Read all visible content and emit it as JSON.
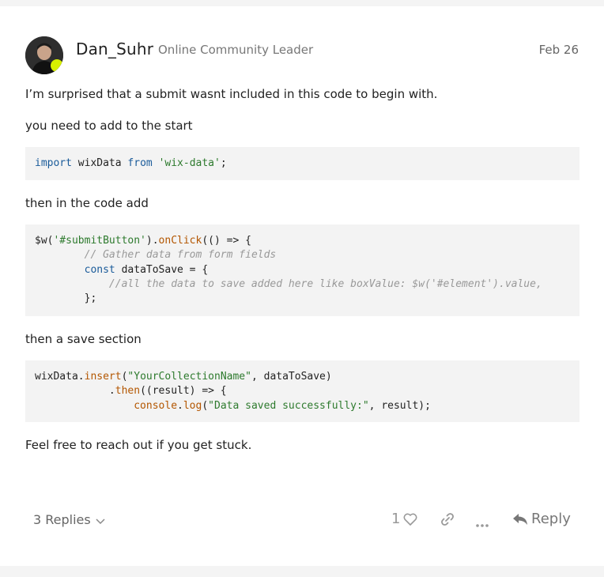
{
  "post": {
    "author": "Dan_Suhr",
    "author_title": "Online Community Leader",
    "date": "Feb 26",
    "paragraphs": [
      "I’m surprised that a submit wasnt included in this code to begin with.",
      "you need to add to the start",
      "then in the code add",
      "then a save section",
      "Feel free to reach out if you get stuck."
    ],
    "code_blocks": [
      "import wixData from 'wix-data';",
      "$w('#submitButton').onClick(() => {\n        // Gather data from form fields\n        const dataToSave = {\n            //all the data to save added here like boxValue: $w('#element').value,\n        };",
      "wixData.insert(\"YourCollectionName\", dataToSave)\n            .then((result) => {\n                console.log(\"Data saved successfully:\", result);"
    ]
  },
  "footer": {
    "replies_label": "3 Replies",
    "like_count": "1",
    "reply_label": "Reply"
  },
  "icons": {
    "like": "heart-icon",
    "link": "link-icon",
    "more": "ellipsis-icon",
    "reply": "reply-arrow-icon",
    "expand": "chevron-down-icon"
  }
}
